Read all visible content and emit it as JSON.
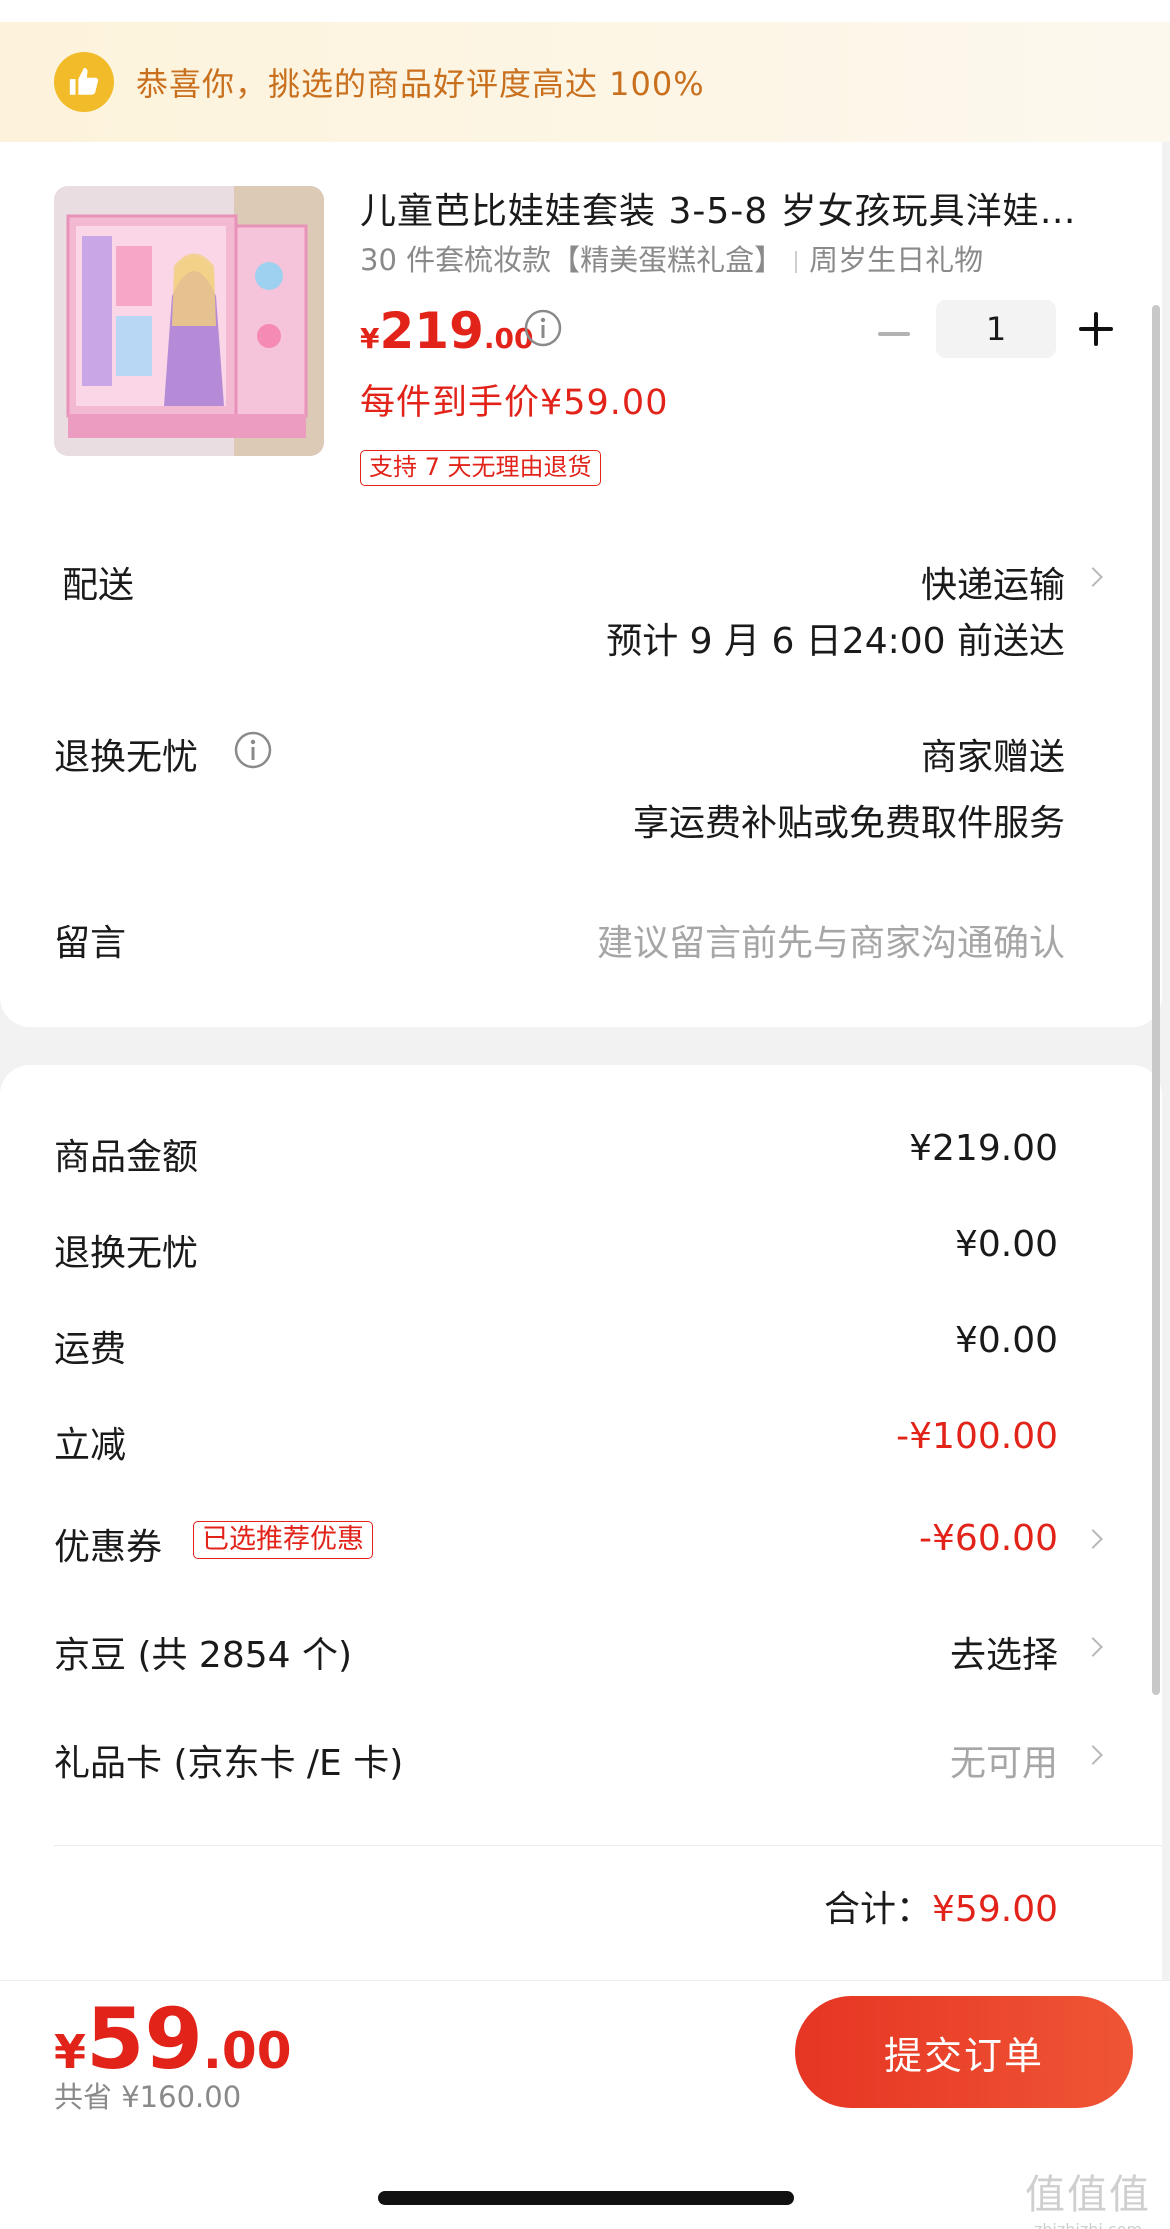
{
  "banner": {
    "text": "恭喜你，挑选的商品好评度高达 100%",
    "icon": "thumbs-up-icon"
  },
  "product": {
    "title": "儿童芭比娃娃套装 3-5-8 岁女孩玩具洋娃…",
    "spec1": "30 件套梳妆款【精美蛋糕礼盒】",
    "spec2": "周岁生日礼物",
    "price_symbol": "¥",
    "price_int": "219",
    "price_dec": ".00",
    "per_price": "每件到手价¥59.00",
    "return_tag": "支持 7 天无理由退货",
    "quantity": "1"
  },
  "delivery": {
    "label": "配送",
    "method": "快递运输",
    "eta": "预计 9 月 6 日24:00 前送达"
  },
  "return_service": {
    "label": "退换无忧",
    "value": "商家赠送",
    "desc": "享运费补贴或免费取件服务"
  },
  "message": {
    "label": "留言",
    "placeholder": "建议留言前先与商家沟通确认"
  },
  "summary": {
    "goods_amount": {
      "label": "商品金额",
      "value": "¥219.00"
    },
    "return_fee": {
      "label": "退换无忧",
      "value": "¥0.00"
    },
    "shipping": {
      "label": "运费",
      "value": "¥0.00"
    },
    "discount": {
      "label": "立减",
      "value": "-¥100.00"
    },
    "coupon": {
      "label": "优惠券",
      "tag": "已选推荐优惠",
      "value": "-¥60.00"
    },
    "jingdou": {
      "label": "京豆 (共 2854 个)",
      "value": "去选择"
    },
    "gift_card": {
      "label": "礼品卡 (京东卡 /E 卡)",
      "value": "无可用"
    },
    "total_label": "合计：",
    "total_value": "¥59.00"
  },
  "footer": {
    "total_symbol": "¥",
    "total_int": "59",
    "total_dec": ".00",
    "saved": "共省 ¥160.00",
    "submit_label": "提交订单"
  },
  "watermark": {
    "logo": "值值值",
    "url": "zhizhizhi.com"
  },
  "colors": {
    "accent_red": "#e2231a",
    "banner_text": "#c9701e",
    "banner_icon": "#f2bb2a",
    "muted": "#a6a6a6"
  }
}
